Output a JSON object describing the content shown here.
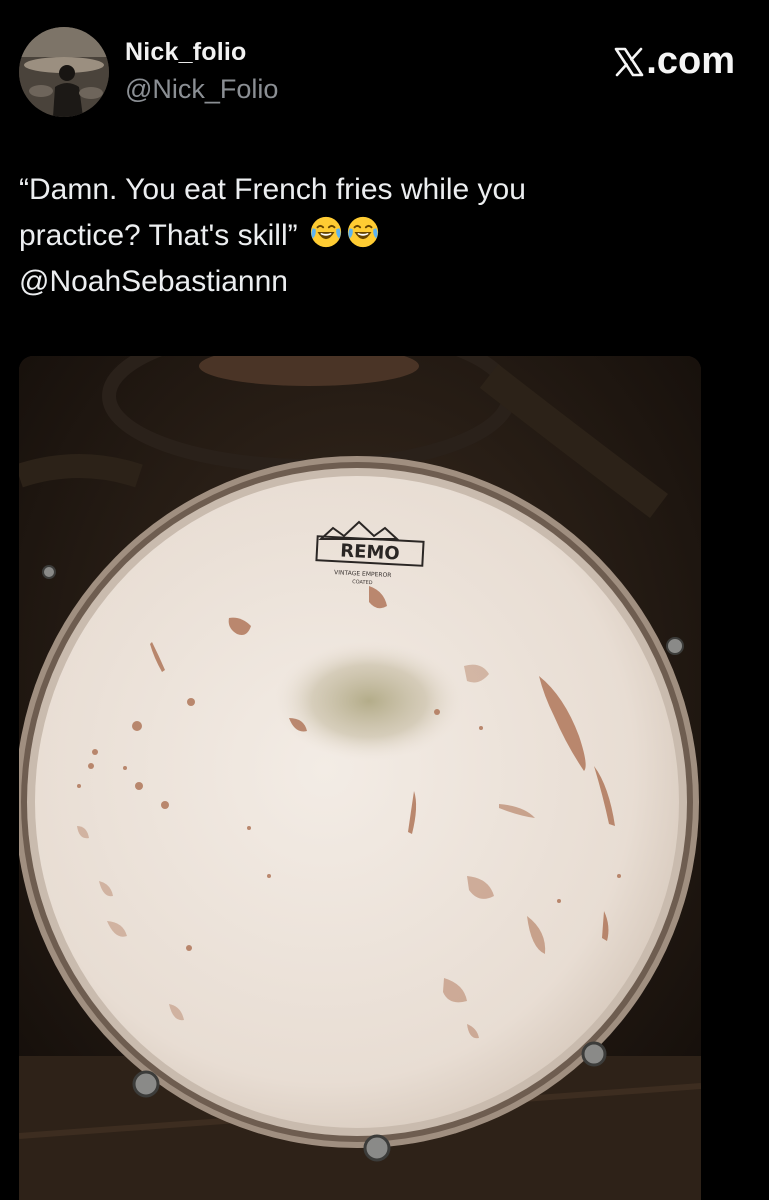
{
  "author": {
    "display_name": "Nick_folio",
    "handle": "@Nick_Folio",
    "avatar_icon": "profile-photo-drummer"
  },
  "brand": {
    "text": ".com",
    "logo_icon": "x-logo-icon"
  },
  "tweet": {
    "line1": "“Damn. You eat French fries while you",
    "line2": "practice? That's skill”",
    "emoji": [
      "face-with-tears-of-joy",
      "face-with-tears-of-joy"
    ],
    "mention": "@NoahSebastiannn"
  },
  "media": {
    "logo_text": "REMO",
    "subtitle_text": "VINTAGE EMPEROR",
    "subtitle_text2": "COATED"
  },
  "colors": {
    "background": "#000000",
    "text_primary": "#e7e9ea",
    "text_secondary": "#8b8f94",
    "drumhead": "#ece4dc"
  }
}
